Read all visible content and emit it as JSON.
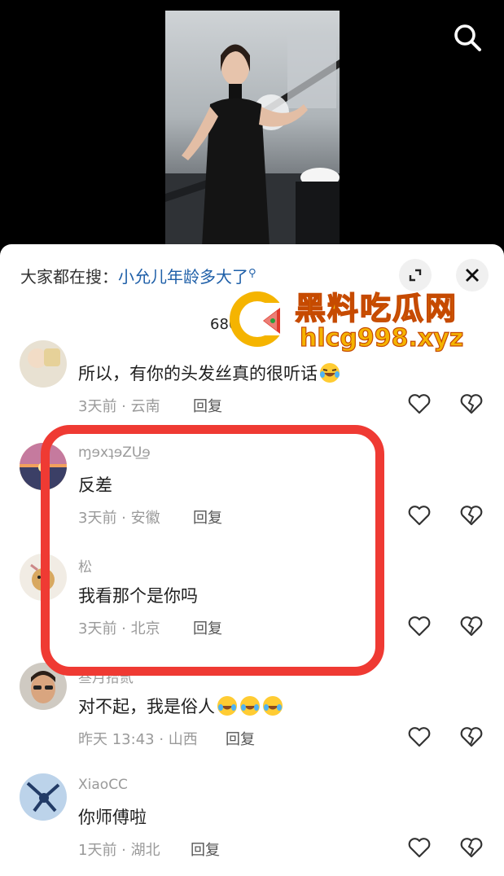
{
  "header": {
    "search_icon": "search-icon"
  },
  "hot_search": {
    "prefix": "大家都在搜：",
    "query": "小允儿年龄多大了"
  },
  "comment_count": "680 条评论",
  "watermark": {
    "title": "黑料吃瓜网",
    "url": "hlcg998.xyz"
  },
  "reply_label": "回复",
  "comments": [
    {
      "username": "",
      "text": "所以，有你的头发丝真的很听话",
      "meta": "3天前 · 云南"
    },
    {
      "username": "ɱɘxʇɘZU͟ɘ",
      "text": "反差",
      "meta": "3天前 · 安徽"
    },
    {
      "username": "松",
      "text": "我看那个是你吗",
      "meta": "3天前 · 北京"
    },
    {
      "username": "叁月拾贰",
      "text": "对不起，我是俗人",
      "meta": "昨天 13:43 · 山西"
    },
    {
      "username": "XiaoCC",
      "text": "你师傅啦",
      "meta": "1天前 · 湖北"
    }
  ],
  "colors": {
    "highlight": "#ef3a33",
    "link": "#1e5fa8",
    "watermark": "#f5b400"
  }
}
